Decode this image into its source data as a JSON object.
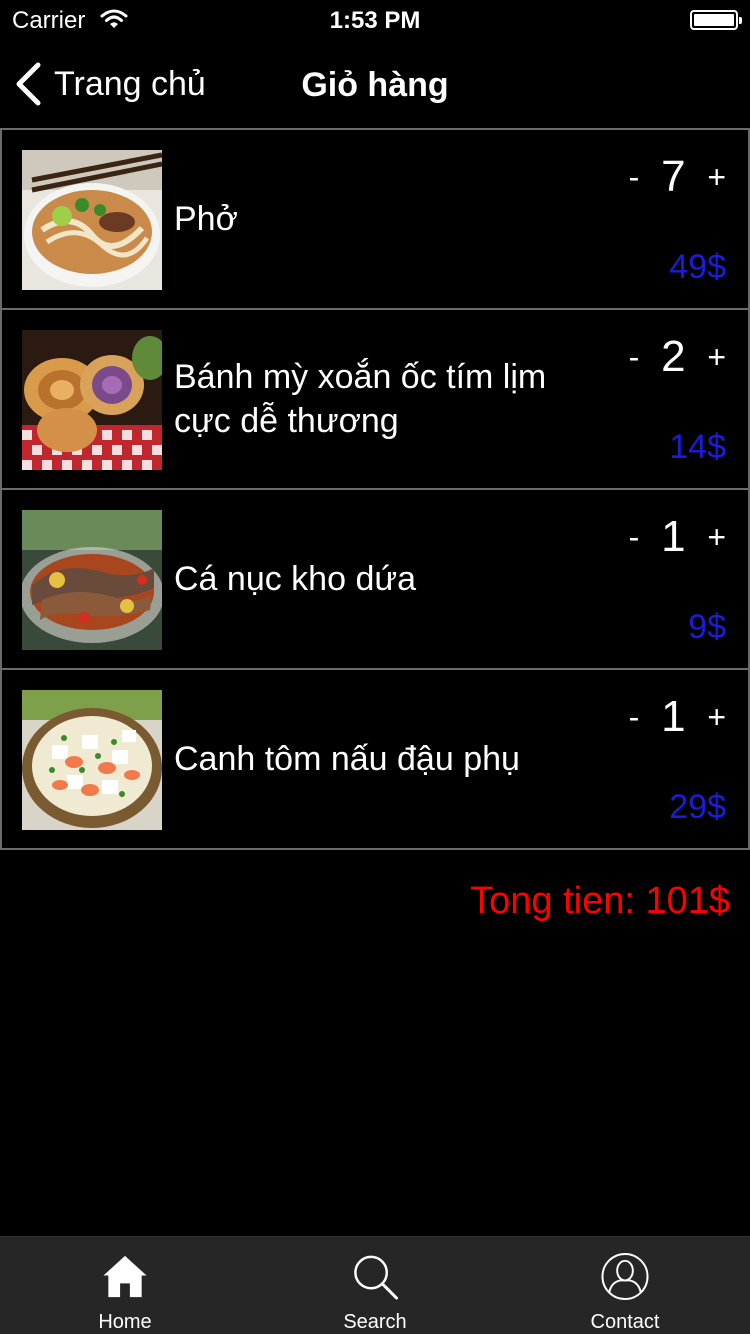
{
  "status_bar": {
    "carrier": "Carrier",
    "time": "1:53 PM",
    "battery_level": 1.0
  },
  "nav": {
    "back_label": "Trang chủ",
    "title": "Giỏ hàng"
  },
  "qty_controls": {
    "minus": "-",
    "plus": "+"
  },
  "items": [
    {
      "name": "Phở",
      "quantity": "7",
      "price": "49$",
      "image": "pho-bowl"
    },
    {
      "name": "Bánh mỳ xoắn ốc tím lịm cực dễ thương",
      "quantity": "2",
      "price": "14$",
      "image": "spiral-bread"
    },
    {
      "name": "Cá nục kho dứa",
      "quantity": "1",
      "price": "9$",
      "image": "braised-fish"
    },
    {
      "name": "Canh tôm nấu đậu phụ",
      "quantity": "1",
      "price": "29$",
      "image": "shrimp-tofu-soup"
    }
  ],
  "total": "Tong tien: 101$",
  "tab_bar": {
    "tabs": [
      {
        "label": "Home",
        "icon": "home-icon"
      },
      {
        "label": "Search",
        "icon": "search-icon"
      },
      {
        "label": "Contact",
        "icon": "contact-icon"
      }
    ]
  },
  "colors": {
    "background": "#000000",
    "price": "#1c1cdb",
    "total": "#ff0000",
    "tab_bar": "#262626"
  }
}
